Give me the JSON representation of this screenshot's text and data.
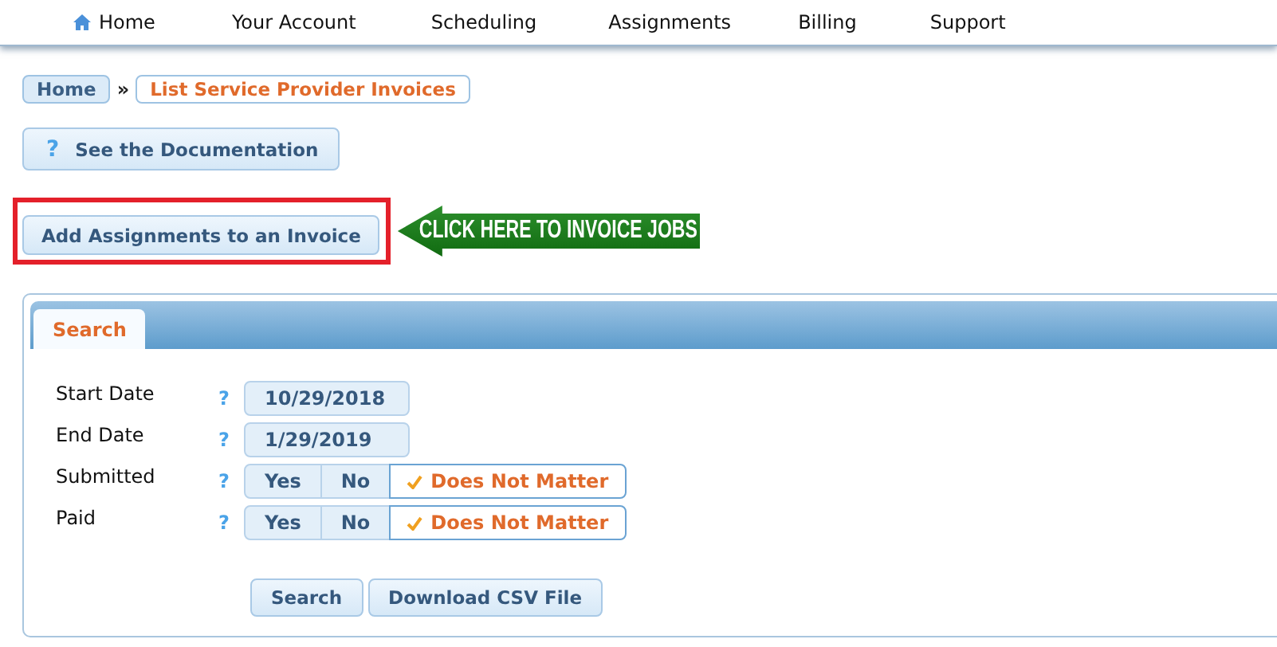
{
  "nav": {
    "items": [
      {
        "label": "Home",
        "icon": true
      },
      {
        "label": "Your Account",
        "icon": false
      },
      {
        "label": "Scheduling",
        "icon": false
      },
      {
        "label": "Assignments",
        "icon": false
      },
      {
        "label": "Billing",
        "icon": false
      },
      {
        "label": "Support",
        "icon": false
      }
    ]
  },
  "breadcrumb": [
    {
      "label": "Home",
      "current": false
    },
    {
      "label": "List Service Provider Invoices",
      "current": true
    }
  ],
  "breadcrumb_separator": "»",
  "doc_button": {
    "icon": "?",
    "label": "See the Documentation"
  },
  "add_button": {
    "label": "Add Assignments to an Invoice",
    "highlighted": true
  },
  "callout": {
    "text": "CLICK HERE TO INVOICE JOBS"
  },
  "panel": {
    "tabs": [
      {
        "label": "Search",
        "selected": true
      }
    ],
    "fields": [
      {
        "kind": "date",
        "label": "Start Date",
        "help": "?",
        "value": "10/29/2018"
      },
      {
        "kind": "date",
        "label": "End Date",
        "help": "?",
        "value": "1/29/2019"
      },
      {
        "kind": "toggle",
        "label": "Submitted",
        "help": "?",
        "options": [
          {
            "label": "Yes",
            "selected": false
          },
          {
            "label": "No",
            "selected": false
          },
          {
            "label": "Does Not Matter",
            "selected": true
          }
        ]
      },
      {
        "kind": "toggle",
        "label": "Paid",
        "help": "?",
        "options": [
          {
            "label": "Yes",
            "selected": false
          },
          {
            "label": "No",
            "selected": false
          },
          {
            "label": "Does Not Matter",
            "selected": true
          }
        ]
      }
    ],
    "buttons": [
      "Search",
      "Download CSV File"
    ]
  }
}
